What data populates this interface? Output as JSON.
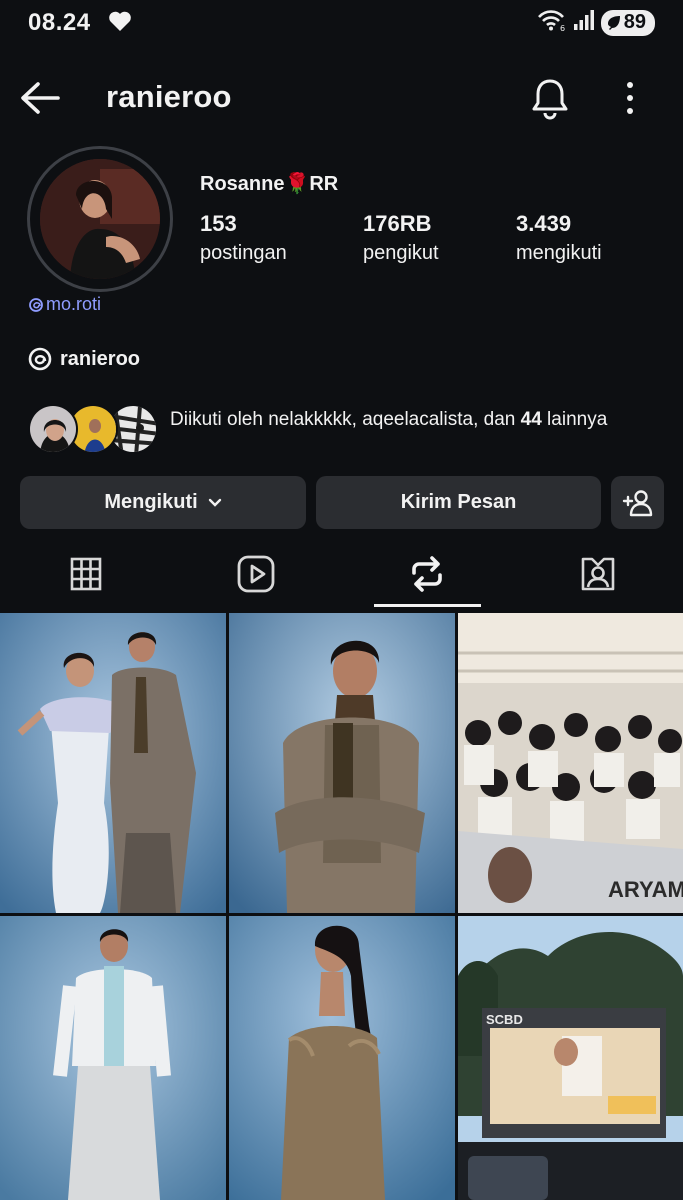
{
  "status_bar": {
    "time": "08.24",
    "battery": "89"
  },
  "header": {
    "username": "ranieroo"
  },
  "profile": {
    "display_name": "Rosanne🌹RR",
    "threads_note": "mo.roti",
    "stats": [
      {
        "value": "153",
        "label": "postingan"
      },
      {
        "value": "176RB",
        "label": "pengikut"
      },
      {
        "value": "3.439",
        "label": "mengikuti"
      }
    ],
    "threads_handle": "ranieroo",
    "followed_by": {
      "prefix": "Diikuti oleh nelakkkkk, aqeelacalista, dan ",
      "count": "44",
      "suffix": " lainnya"
    }
  },
  "actions": {
    "following_label": "Mengikuti",
    "message_label": "Kirim Pesan"
  },
  "tabs": [
    {
      "icon": "grid-icon",
      "active": false
    },
    {
      "icon": "reels-icon",
      "active": false
    },
    {
      "icon": "repost-icon",
      "active": true
    },
    {
      "icon": "tagged-icon",
      "active": false
    }
  ],
  "posts": [
    {
      "overlay_text": "",
      "colors": [
        "#8fb1cf",
        "#3d6d95"
      ]
    },
    {
      "overlay_text": "",
      "colors": [
        "#8fb1cf",
        "#3a6891"
      ]
    },
    {
      "overlay_text": "ARYAMOI",
      "colors": [
        "#d9d4cc",
        "#3b3a3c"
      ]
    },
    {
      "overlay_text": "",
      "colors": [
        "#8ab0cf",
        "#4a7aa1"
      ]
    },
    {
      "overlay_text": "",
      "colors": [
        "#7da7cc",
        "#3b6e98"
      ]
    },
    {
      "overlay_text": "SCBD",
      "colors": [
        "#a8c8e6",
        "#2f3c35"
      ]
    }
  ]
}
